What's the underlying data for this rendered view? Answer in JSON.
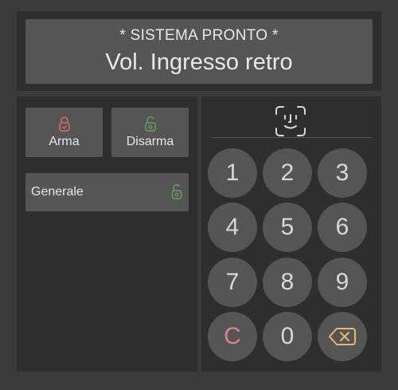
{
  "display": {
    "status": "* SISTEMA PRONTO *",
    "zone": "Vol. Ingresso retro"
  },
  "modes": {
    "arm_label": "Arma",
    "disarm_label": "Disarma"
  },
  "areas": [
    {
      "label": "Generale"
    }
  ],
  "keypad": {
    "keys": [
      "1",
      "2",
      "3",
      "4",
      "5",
      "6",
      "7",
      "8",
      "9",
      "C",
      "0"
    ]
  },
  "colors": {
    "arm_accent": "#d96b6b",
    "disarm_accent": "#67a45a",
    "clear_key": "#e08080",
    "backspace_accent": "#e8b866"
  },
  "icons": {
    "arm": "lock-closed-icon",
    "disarm": "lock-open-icon",
    "area_status": "lock-open-icon",
    "face": "face-id-icon",
    "backspace": "backspace-icon"
  }
}
